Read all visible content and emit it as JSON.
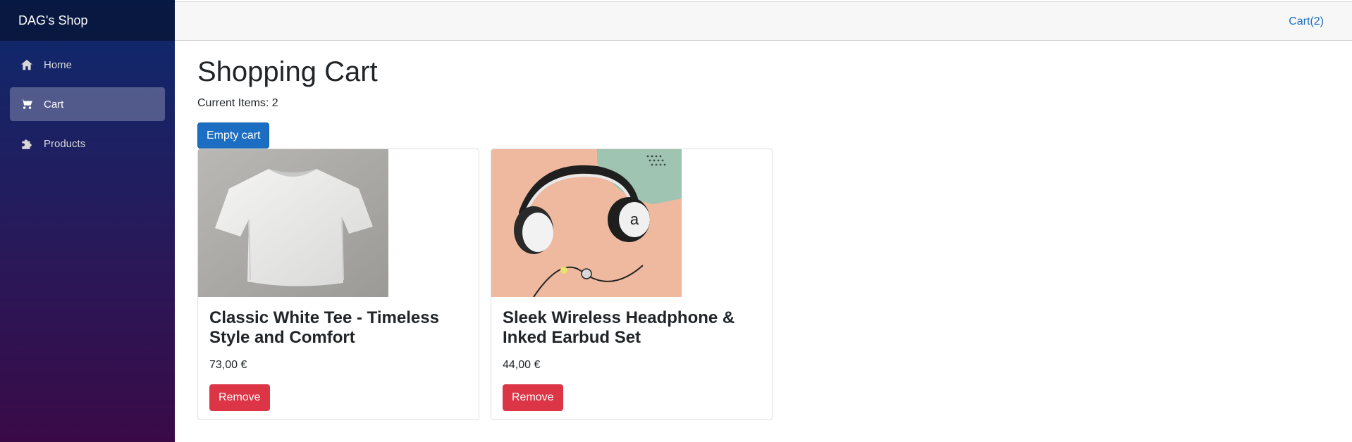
{
  "sidebar": {
    "brand": "DAG's Shop",
    "items": [
      {
        "label": "Home",
        "icon": "home-icon"
      },
      {
        "label": "Cart",
        "icon": "cart-icon",
        "active": true
      },
      {
        "label": "Products",
        "icon": "puzzle-icon"
      }
    ]
  },
  "topbar": {
    "cart_link": "Cart(2)"
  },
  "main": {
    "title": "Shopping Cart",
    "items_label": "Current Items: 2",
    "empty_button": "Empty cart",
    "products": [
      {
        "name": "Classic White Tee - Timeless Style and Comfort",
        "price": "73,00 €",
        "remove_label": "Remove",
        "image": "white-tshirt-image"
      },
      {
        "name": "Sleek Wireless Headphone & Inked Earbud Set",
        "price": "44,00 €",
        "remove_label": "Remove",
        "image": "headphones-image"
      }
    ]
  },
  "colors": {
    "primary": "#1b6ec2",
    "danger": "#dc3545",
    "sidebar_top": "#0d2a6e",
    "sidebar_bottom": "#3a0a47"
  }
}
